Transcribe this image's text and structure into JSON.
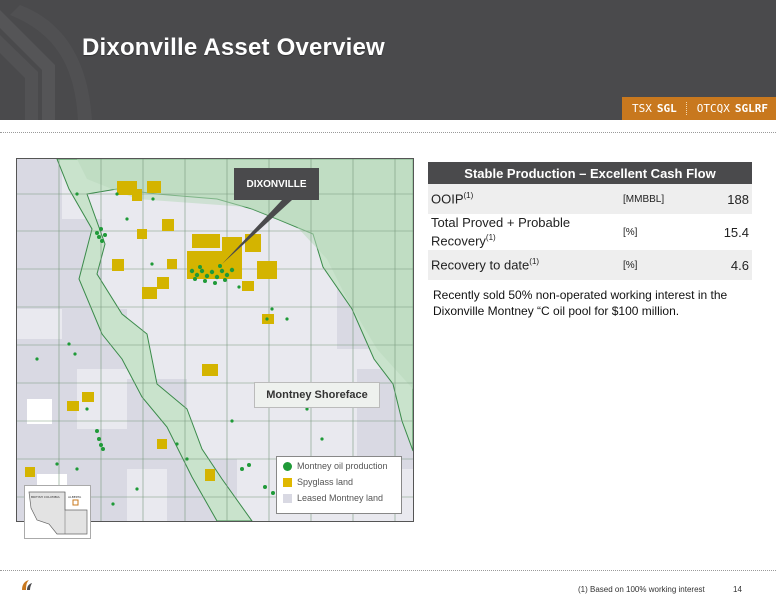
{
  "slide": {
    "title": "Dixonville Asset Overview",
    "page_number": "14"
  },
  "ticker": {
    "exchange1": "TSX",
    "symbol1": "SGL",
    "exchange2": "OTCQX",
    "symbol2": "SGLRF"
  },
  "map": {
    "callout": "DIXONVILLE",
    "shoreface_label": "Montney Shoreface",
    "legend": [
      {
        "label": "Montney oil production",
        "color": "#1f9a38"
      },
      {
        "label": "Spyglass land",
        "color": "#e0b800"
      },
      {
        "label": "Leased Montney land",
        "color": "#d9d9e3"
      }
    ],
    "inset_labels": [
      "BRITISH COLUMBIA",
      "ALBERTA"
    ]
  },
  "table": {
    "title": "Stable Production – Excellent Cash Flow",
    "rows": [
      {
        "label": "OOIP",
        "sup": "(1)",
        "label2": "",
        "unit": "[MMBBL]",
        "value": "188"
      },
      {
        "label": "Total Proved + Probable",
        "sup": "(1)",
        "label2": "Recovery",
        "unit": "[%]",
        "value": "15.4"
      },
      {
        "label": "Recovery to date",
        "sup": "(1)",
        "label2": "",
        "unit": "[%]",
        "value": "4.6"
      }
    ]
  },
  "note": "Recently sold 50% non-operated working interest in the Dixonville Montney “C oil pool for $100 million.",
  "footnote": "(1) Based on 100% working interest",
  "colors": {
    "header_gray": "#4a4a4c",
    "ticker_orange": "#c8781e",
    "shoreface_green": "#c9e3cc",
    "spyglass_yellow": "#d4b400",
    "production_green": "#1f9a38"
  }
}
